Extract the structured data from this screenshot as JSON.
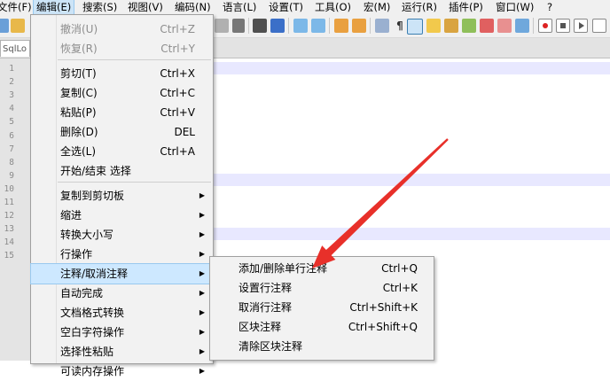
{
  "menubar": {
    "items": [
      "文件(F)",
      "编辑(E)",
      "搜索(S)",
      "视图(V)",
      "编码(N)",
      "语言(L)",
      "设置(T)",
      "工具(O)",
      "宏(M)",
      "运行(R)",
      "插件(P)",
      "窗口(W)",
      "?"
    ]
  },
  "tab": {
    "label": "SqlLo"
  },
  "editor": {
    "line_numbers": [
      "1",
      "2",
      "3",
      "4",
      "5",
      "6",
      "7",
      "8",
      "9",
      "10",
      "11",
      "12",
      "13",
      "14",
      "15"
    ]
  },
  "edit_menu": {
    "items": [
      {
        "label": "撤消(U)",
        "shortcut": "Ctrl+Z",
        "disabled": true
      },
      {
        "label": "恢复(R)",
        "shortcut": "Ctrl+Y",
        "disabled": true
      },
      {
        "label": "剪切(T)",
        "shortcut": "Ctrl+X"
      },
      {
        "label": "复制(C)",
        "shortcut": "Ctrl+C"
      },
      {
        "label": "粘贴(P)",
        "shortcut": "Ctrl+V"
      },
      {
        "label": "删除(D)",
        "shortcut": "DEL"
      },
      {
        "label": "全选(L)",
        "shortcut": "Ctrl+A"
      },
      {
        "label": "开始/结束 选择",
        "shortcut": ""
      },
      {
        "label": "复制到剪切板",
        "submenu": true
      },
      {
        "label": "缩进",
        "submenu": true
      },
      {
        "label": "转换大小写",
        "submenu": true
      },
      {
        "label": "行操作",
        "submenu": true
      },
      {
        "label": "注释/取消注释",
        "submenu": true
      },
      {
        "label": "自动完成",
        "submenu": true
      },
      {
        "label": "文档格式转换",
        "submenu": true
      },
      {
        "label": "空白字符操作",
        "submenu": true
      },
      {
        "label": "选择性粘贴",
        "submenu": true
      },
      {
        "label": "可读内存操作",
        "submenu": true
      }
    ]
  },
  "comment_submenu": {
    "items": [
      {
        "label": "添加/删除单行注释",
        "shortcut": "Ctrl+Q"
      },
      {
        "label": "设置行注释",
        "shortcut": "Ctrl+K"
      },
      {
        "label": "取消行注释",
        "shortcut": "Ctrl+Shift+K"
      },
      {
        "label": "区块注释",
        "shortcut": "Ctrl+Shift+Q"
      },
      {
        "label": "清除区块注释",
        "shortcut": ""
      }
    ]
  },
  "colors": {
    "arrow": "#e8302a",
    "hover": "#cde8ff",
    "line_highlight": "#e8e8ff"
  }
}
